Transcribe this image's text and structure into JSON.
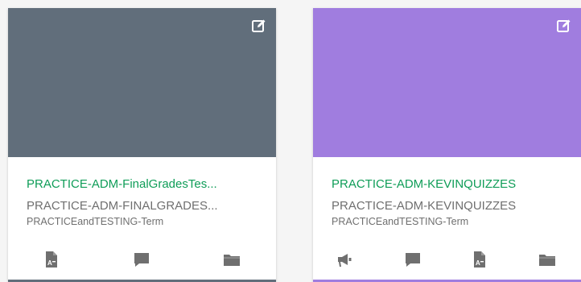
{
  "cards": [
    {
      "title": "PRACTICE-ADM-FinalGradesTes...",
      "subtitle": "PRACTICE-ADM-FINALGRADES...",
      "term": "PRACTICEandTESTING-Term",
      "hero_color": "#616e7b",
      "edit_icon": "edit-icon",
      "actions": [
        "assignments-icon",
        "discussions-icon",
        "files-icon"
      ]
    },
    {
      "title": "PRACTICE-ADM-KEVINQUIZZES",
      "subtitle": "PRACTICE-ADM-KEVINQUIZZES",
      "term": "PRACTICEandTESTING-Term",
      "hero_color": "#a07ddf",
      "edit_icon": "edit-icon",
      "actions": [
        "announcements-icon",
        "discussions-icon",
        "assignments-icon",
        "files-icon"
      ]
    }
  ],
  "colors": {
    "title": "#0f9d58",
    "subtitle": "#6f6f6f",
    "icon": "#6f6f6f"
  }
}
